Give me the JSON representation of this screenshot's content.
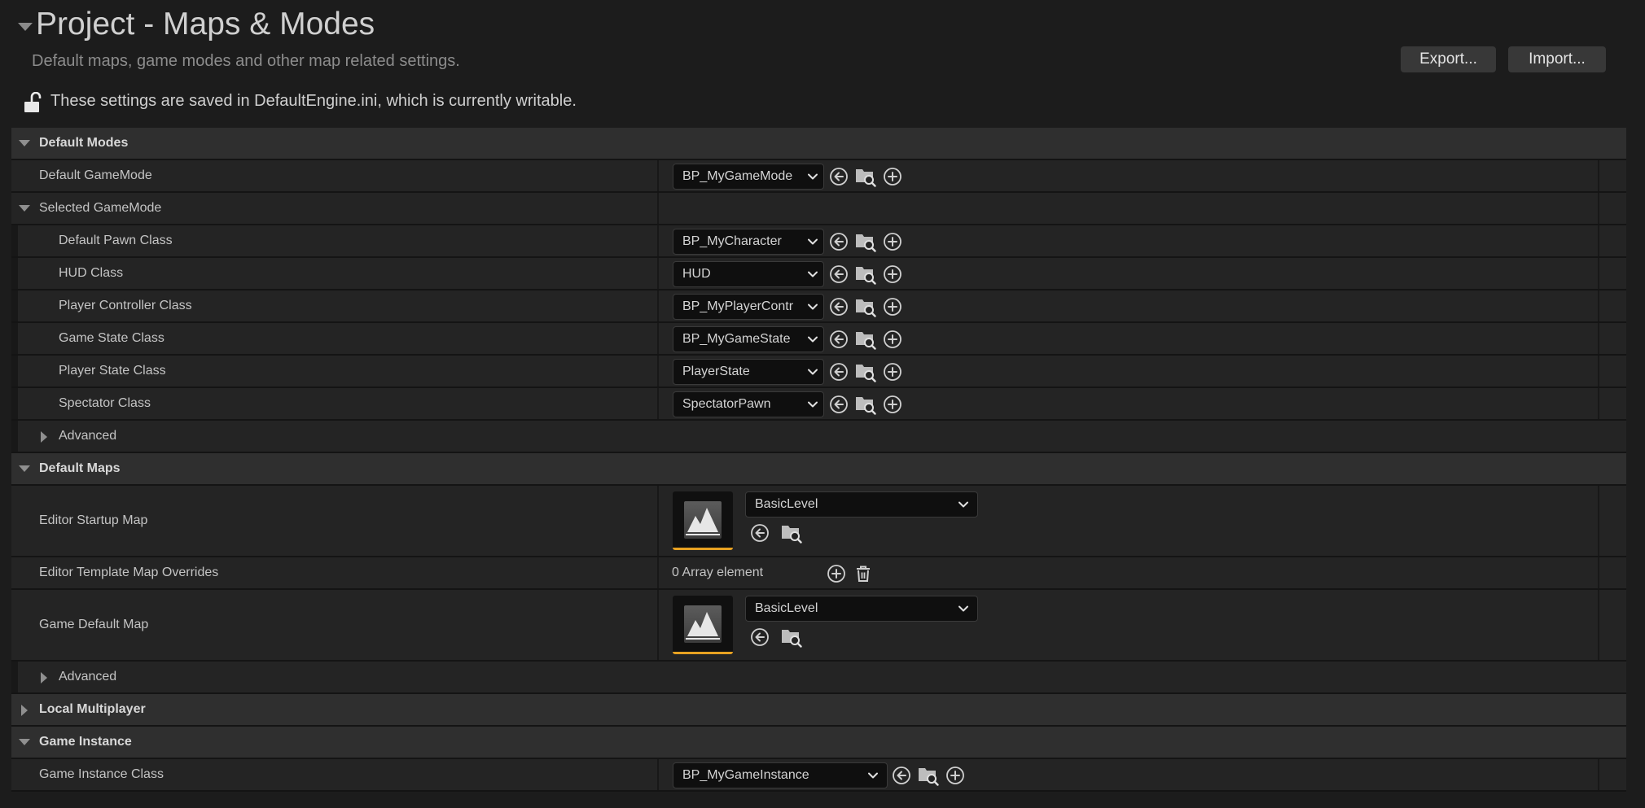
{
  "header": {
    "title": "Project - Maps & Modes",
    "subtitle": "Default maps, game modes and other map related settings.",
    "export_label": "Export...",
    "import_label": "Import...",
    "notice": "These settings are saved in DefaultEngine.ini, which is currently writable."
  },
  "default_modes": {
    "label": "Default Modes",
    "default_gamemode": {
      "label": "Default GameMode",
      "value": "BP_MyGameMode"
    },
    "selected_gamemode": {
      "label": "Selected GameMode",
      "rows": [
        {
          "label": "Default Pawn Class",
          "value": "BP_MyCharacter"
        },
        {
          "label": "HUD Class",
          "value": "HUD"
        },
        {
          "label": "Player Controller Class",
          "value": "BP_MyPlayerContr"
        },
        {
          "label": "Game State Class",
          "value": "BP_MyGameState"
        },
        {
          "label": "Player State Class",
          "value": "PlayerState"
        },
        {
          "label": "Spectator Class",
          "value": "SpectatorPawn"
        }
      ],
      "advanced_label": "Advanced"
    }
  },
  "default_maps": {
    "label": "Default Maps",
    "editor_startup_map": {
      "label": "Editor Startup Map",
      "value": "BasicLevel"
    },
    "editor_template_overrides": {
      "label": "Editor Template Map Overrides",
      "value": "0 Array element"
    },
    "game_default_map": {
      "label": "Game Default Map",
      "value": "BasicLevel"
    },
    "advanced_label": "Advanced"
  },
  "local_multiplayer": {
    "label": "Local Multiplayer"
  },
  "game_instance": {
    "label": "Game Instance",
    "class": {
      "label": "Game Instance Class",
      "value": "BP_MyGameInstance"
    }
  },
  "icons": {
    "row_actions": [
      "arrow-left-circle-icon",
      "browse-folder-icon",
      "add-circle-icon"
    ],
    "array_actions": [
      "add-circle-icon",
      "trash-icon"
    ],
    "map_thumbnail": "level-thumbnail-icon"
  },
  "colors": {
    "background": "#1c1c1c",
    "category_bg": "#2f2f2f",
    "row_bg": "#242424",
    "combo_bg": "#0f0f0f",
    "accent": "#e8a222"
  }
}
